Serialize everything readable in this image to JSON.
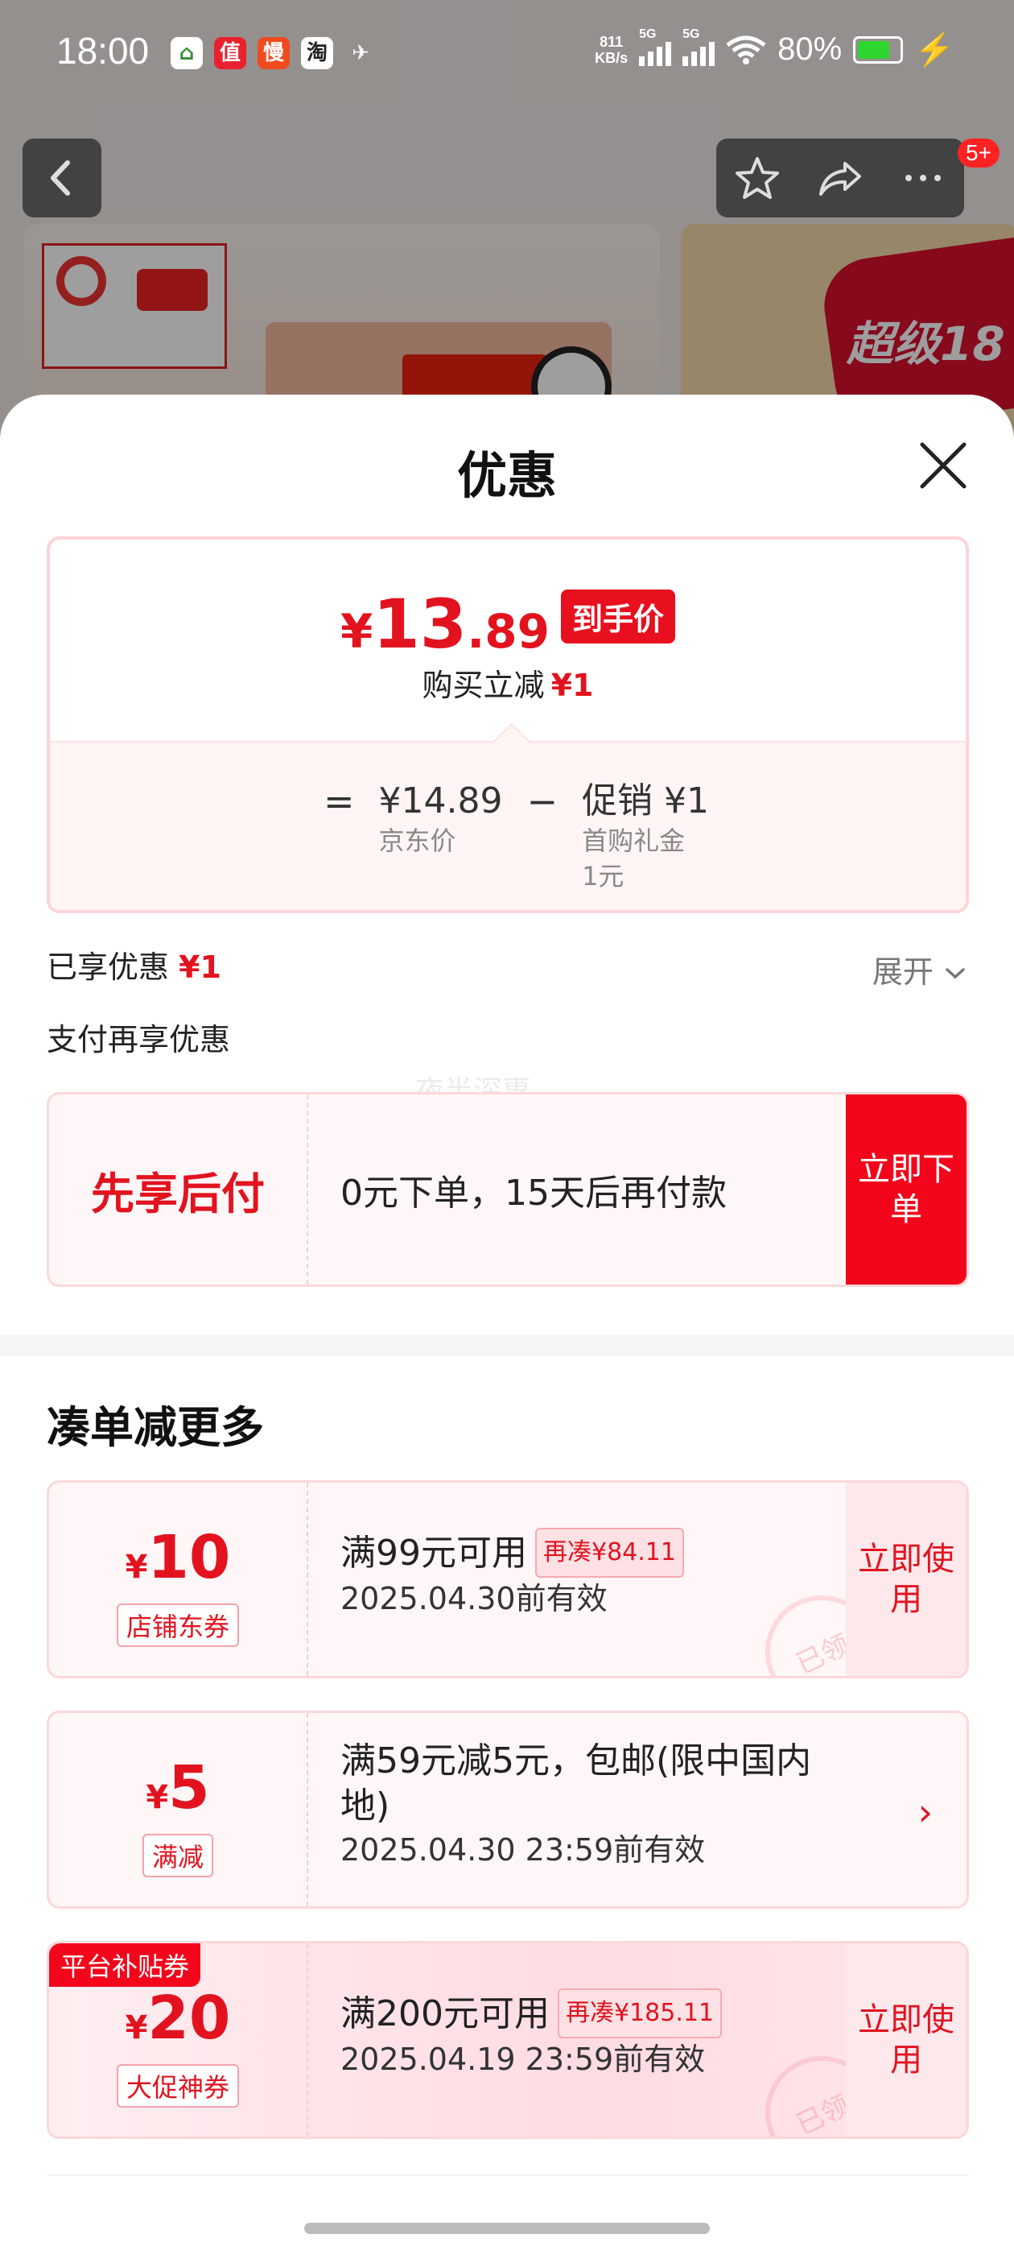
{
  "status_bar": {
    "time": "18:00",
    "net_speed_value": "811",
    "net_speed_unit": "KB/s",
    "sim1": "5G",
    "sim2": "5G",
    "battery_percent": "80%",
    "battery_level": 0.8,
    "app_icons": [
      "home-app-icon",
      "zhi-app-icon",
      "man-app-icon",
      "taobao-app-icon",
      "bird-app-icon"
    ],
    "app_icon_glyphs": [
      "⌂",
      "值",
      "慢",
      "淘",
      "✈"
    ]
  },
  "nav": {
    "badge": "5+"
  },
  "background": {
    "banner_text": "超级18"
  },
  "sheet": {
    "title": "优惠"
  },
  "price_card": {
    "yen": "¥",
    "integer": "13",
    "decimal": ".89",
    "badge": "到手价",
    "sub_label": "购买立减",
    "sub_amount": "¥1",
    "equals": "=",
    "minus": "−",
    "jd_price_value": "¥14.89",
    "jd_price_label": "京东价",
    "promo_value": "促销 ¥1",
    "promo_label_1": "首购礼金",
    "promo_label_2": "1元"
  },
  "enjoyed": {
    "label": "已享优惠",
    "amount": "¥1",
    "expand": "展开"
  },
  "pay_more_title": "支付再享优惠",
  "watermark": "夜半深惠",
  "bnpl": {
    "title": "先享后付",
    "desc": "0元下单，15天后再付款",
    "cta": "立即下单"
  },
  "more_section_title": "凑单减更多",
  "coupons": [
    {
      "yen": "¥",
      "amount": "10",
      "tag": "店铺东券",
      "line1": "满99元可用",
      "more": "再凑¥84.11",
      "line2": "2025.04.30前有效",
      "cta": "立即使用",
      "stamp": "已领"
    },
    {
      "yen": "¥",
      "amount": "5",
      "tag": "满减",
      "line1": "满59元减5元，包邮(限中国内地)",
      "line2": "2025.04.30 23:59前有效",
      "arrow": "›"
    },
    {
      "platform_tag": "平台补贴券",
      "yen": "¥",
      "amount": "20",
      "tag": "大促神券",
      "line1": "满200元可用",
      "more": "再凑¥185.11",
      "line2": "2025.04.19 23:59前有效",
      "cta": "立即使用",
      "stamp": "已领"
    }
  ],
  "colors": {
    "accent_red": "#e2131f",
    "cta_red": "#f3061b",
    "card_border": "#fcd8db"
  }
}
